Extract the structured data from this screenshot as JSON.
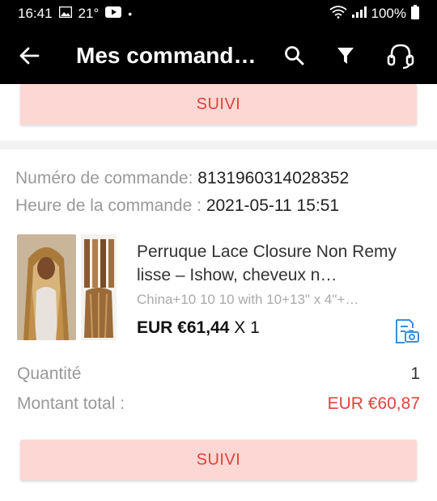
{
  "status_bar": {
    "time": "16:41",
    "temp": "21°",
    "dot": "•",
    "battery": "100%"
  },
  "app_bar": {
    "title": "Mes command…"
  },
  "colors": {
    "accent": "#e0423a",
    "button_bg": "#fdd7d4"
  },
  "top_card": {
    "button_label": "SUIVI"
  },
  "order": {
    "number_label": "Numéro de commande:",
    "number_value": "8131960314028352",
    "time_label": "Heure de la commande :",
    "time_value": "2021-05-11 15:51",
    "product": {
      "title": "Perruque Lace Closure Non Remy lisse – Ishow, cheveux n…",
      "variant": "China+10 10 10 with 10+13\" x 4\"+…",
      "price": "EUR €61,44",
      "qty_suffix": "X 1"
    },
    "quantity_label": "Quantité",
    "quantity_value": "1",
    "total_label": "Montant total :",
    "total_value": "EUR €60,87",
    "button_label": "SUIVI"
  }
}
